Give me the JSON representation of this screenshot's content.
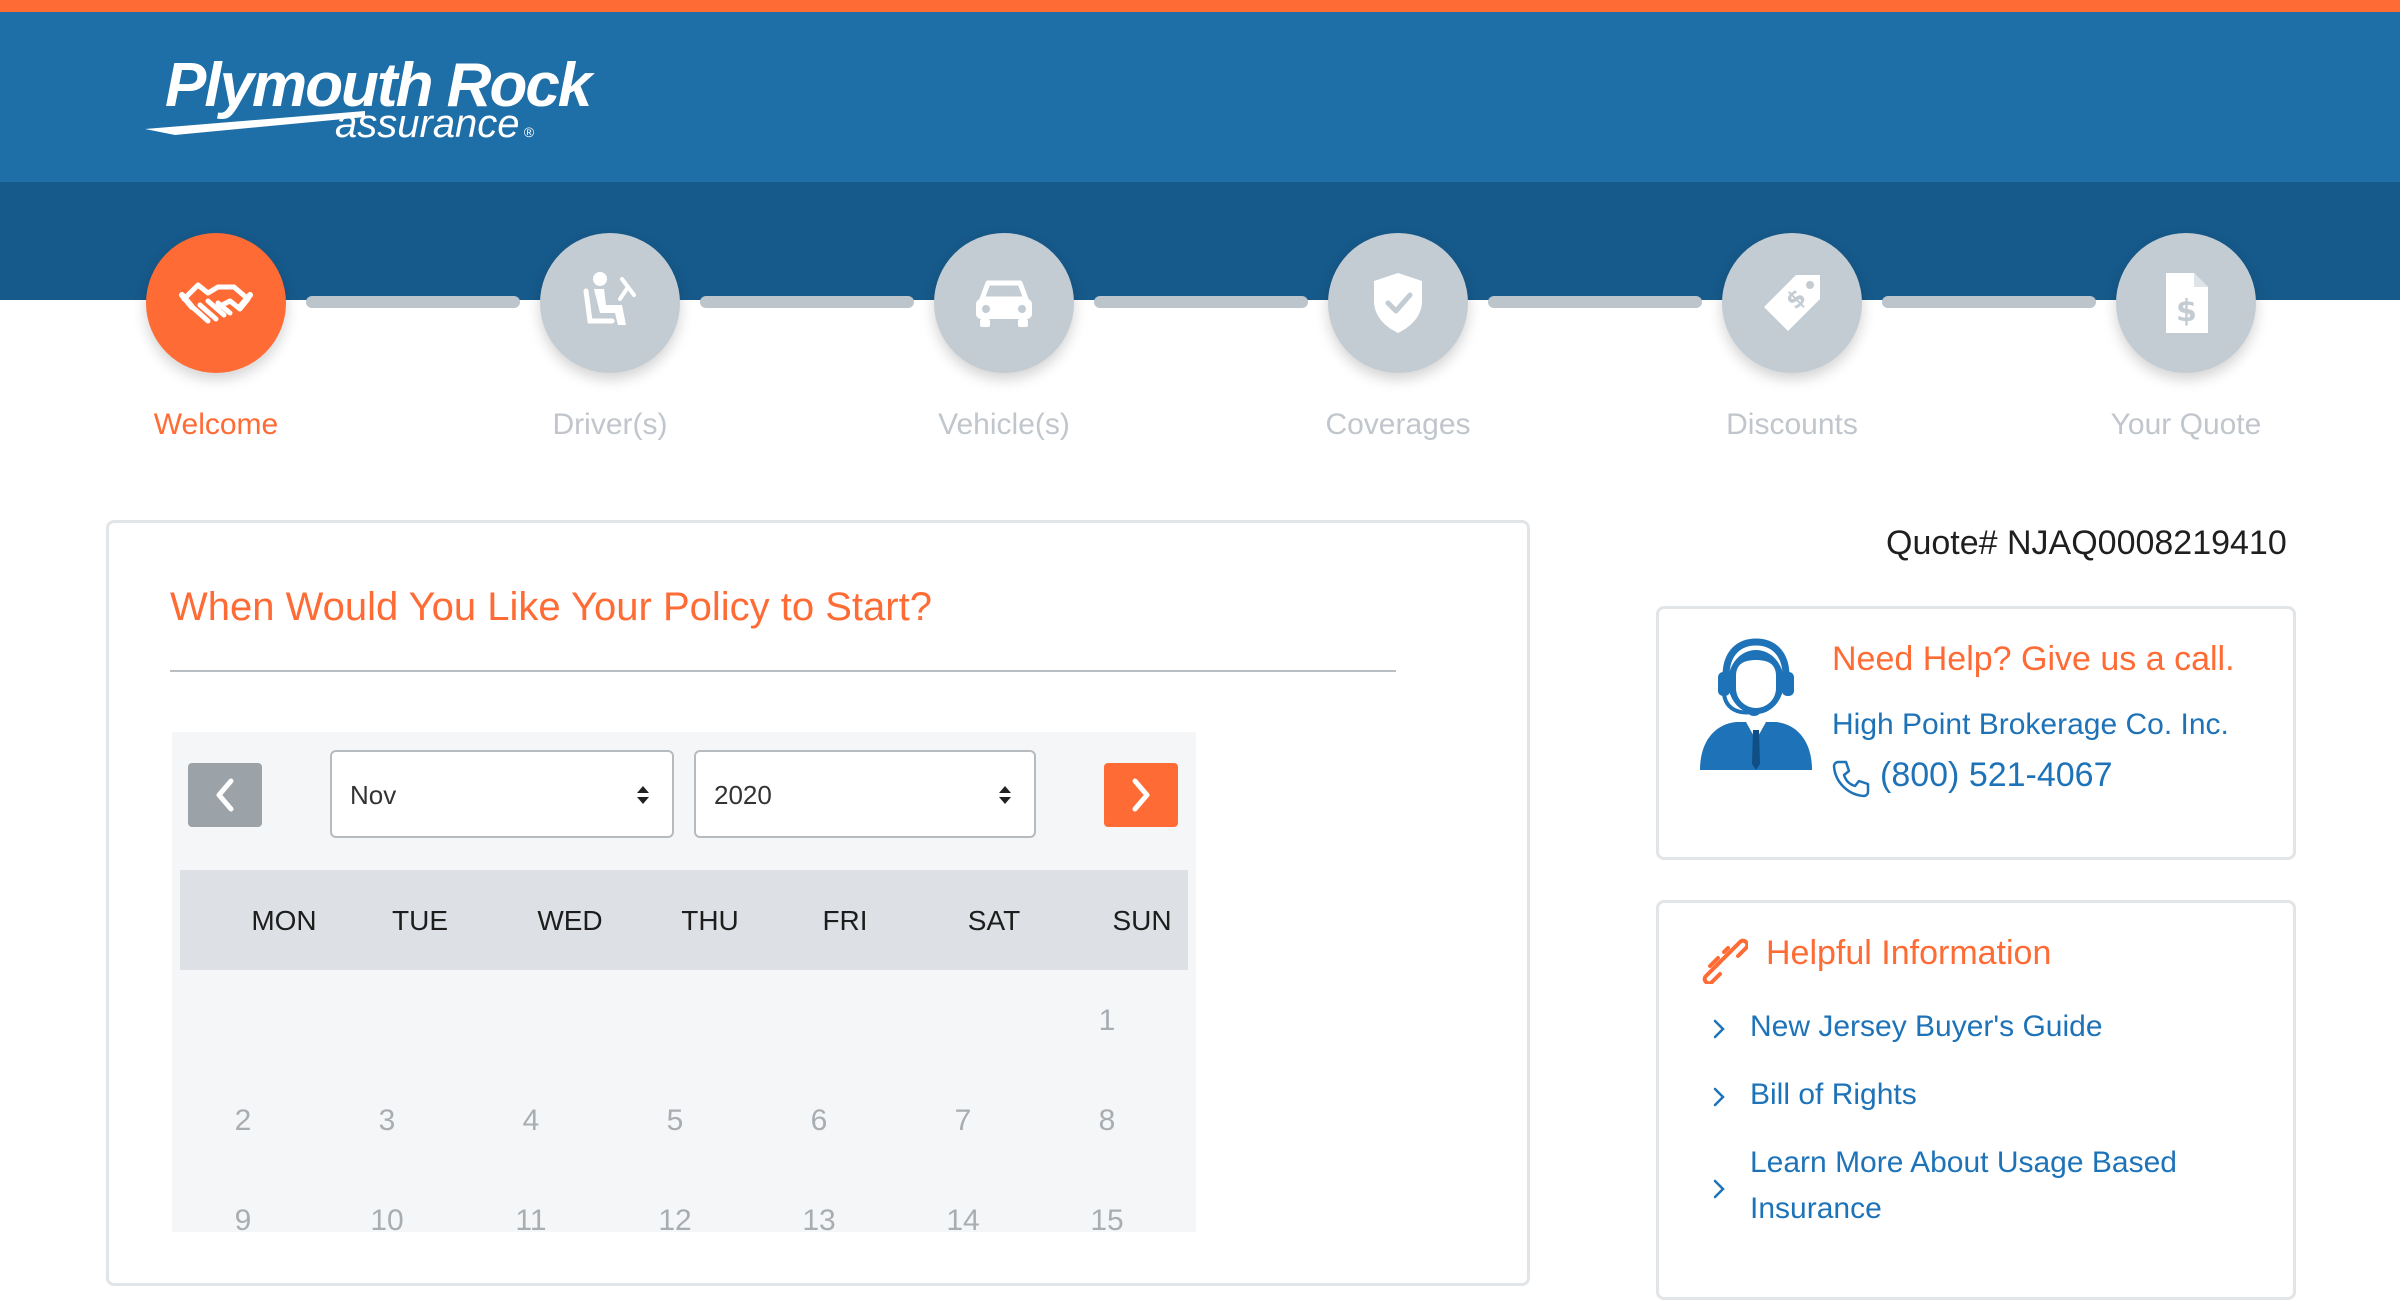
{
  "brand": {
    "name_line1": "Plymouth Rock",
    "name_line2": "assurance",
    "reg": "®"
  },
  "colors": {
    "accent": "#ff6b35",
    "header_blue": "#1e6ea8",
    "band_blue": "#165a8b",
    "link_blue": "#1e73b8",
    "inactive_step": "#c3ccd3"
  },
  "steps": [
    {
      "label": "Welcome",
      "icon": "handshake-icon",
      "active": true
    },
    {
      "label": "Driver(s)",
      "icon": "driver-seat-icon",
      "active": false
    },
    {
      "label": "Vehicle(s)",
      "icon": "car-icon",
      "active": false
    },
    {
      "label": "Coverages",
      "icon": "shield-check-icon",
      "active": false
    },
    {
      "label": "Discounts",
      "icon": "price-tag-icon",
      "active": false
    },
    {
      "label": "Your Quote",
      "icon": "dollar-document-icon",
      "active": false
    }
  ],
  "main": {
    "title": "When Would You Like Your Policy to Start?",
    "calendar": {
      "month": "Nov",
      "year": "2020",
      "weekdays": [
        "MON",
        "TUE",
        "WED",
        "THU",
        "FRI",
        "SAT",
        "SUN"
      ],
      "rows": [
        [
          "",
          "",
          "",
          "",
          "",
          "",
          "1"
        ],
        [
          "2",
          "3",
          "4",
          "5",
          "6",
          "7",
          "8"
        ],
        [
          "9",
          "10",
          "11",
          "12",
          "13",
          "14",
          "15"
        ]
      ]
    }
  },
  "sidebar": {
    "quote_number": "Quote# NJAQ0008219410",
    "help": {
      "title": "Need Help? Give us a call.",
      "broker": "High Point Brokerage Co. Inc.",
      "phone": "(800) 521-4067",
      "agent_icon": "headset-agent-icon",
      "phone_icon": "phone-icon"
    },
    "info": {
      "title": "Helpful Information",
      "icon": "link-icon",
      "links": [
        "New Jersey Buyer's Guide",
        "Bill of Rights",
        "Learn More About Usage Based Insurance"
      ]
    }
  }
}
